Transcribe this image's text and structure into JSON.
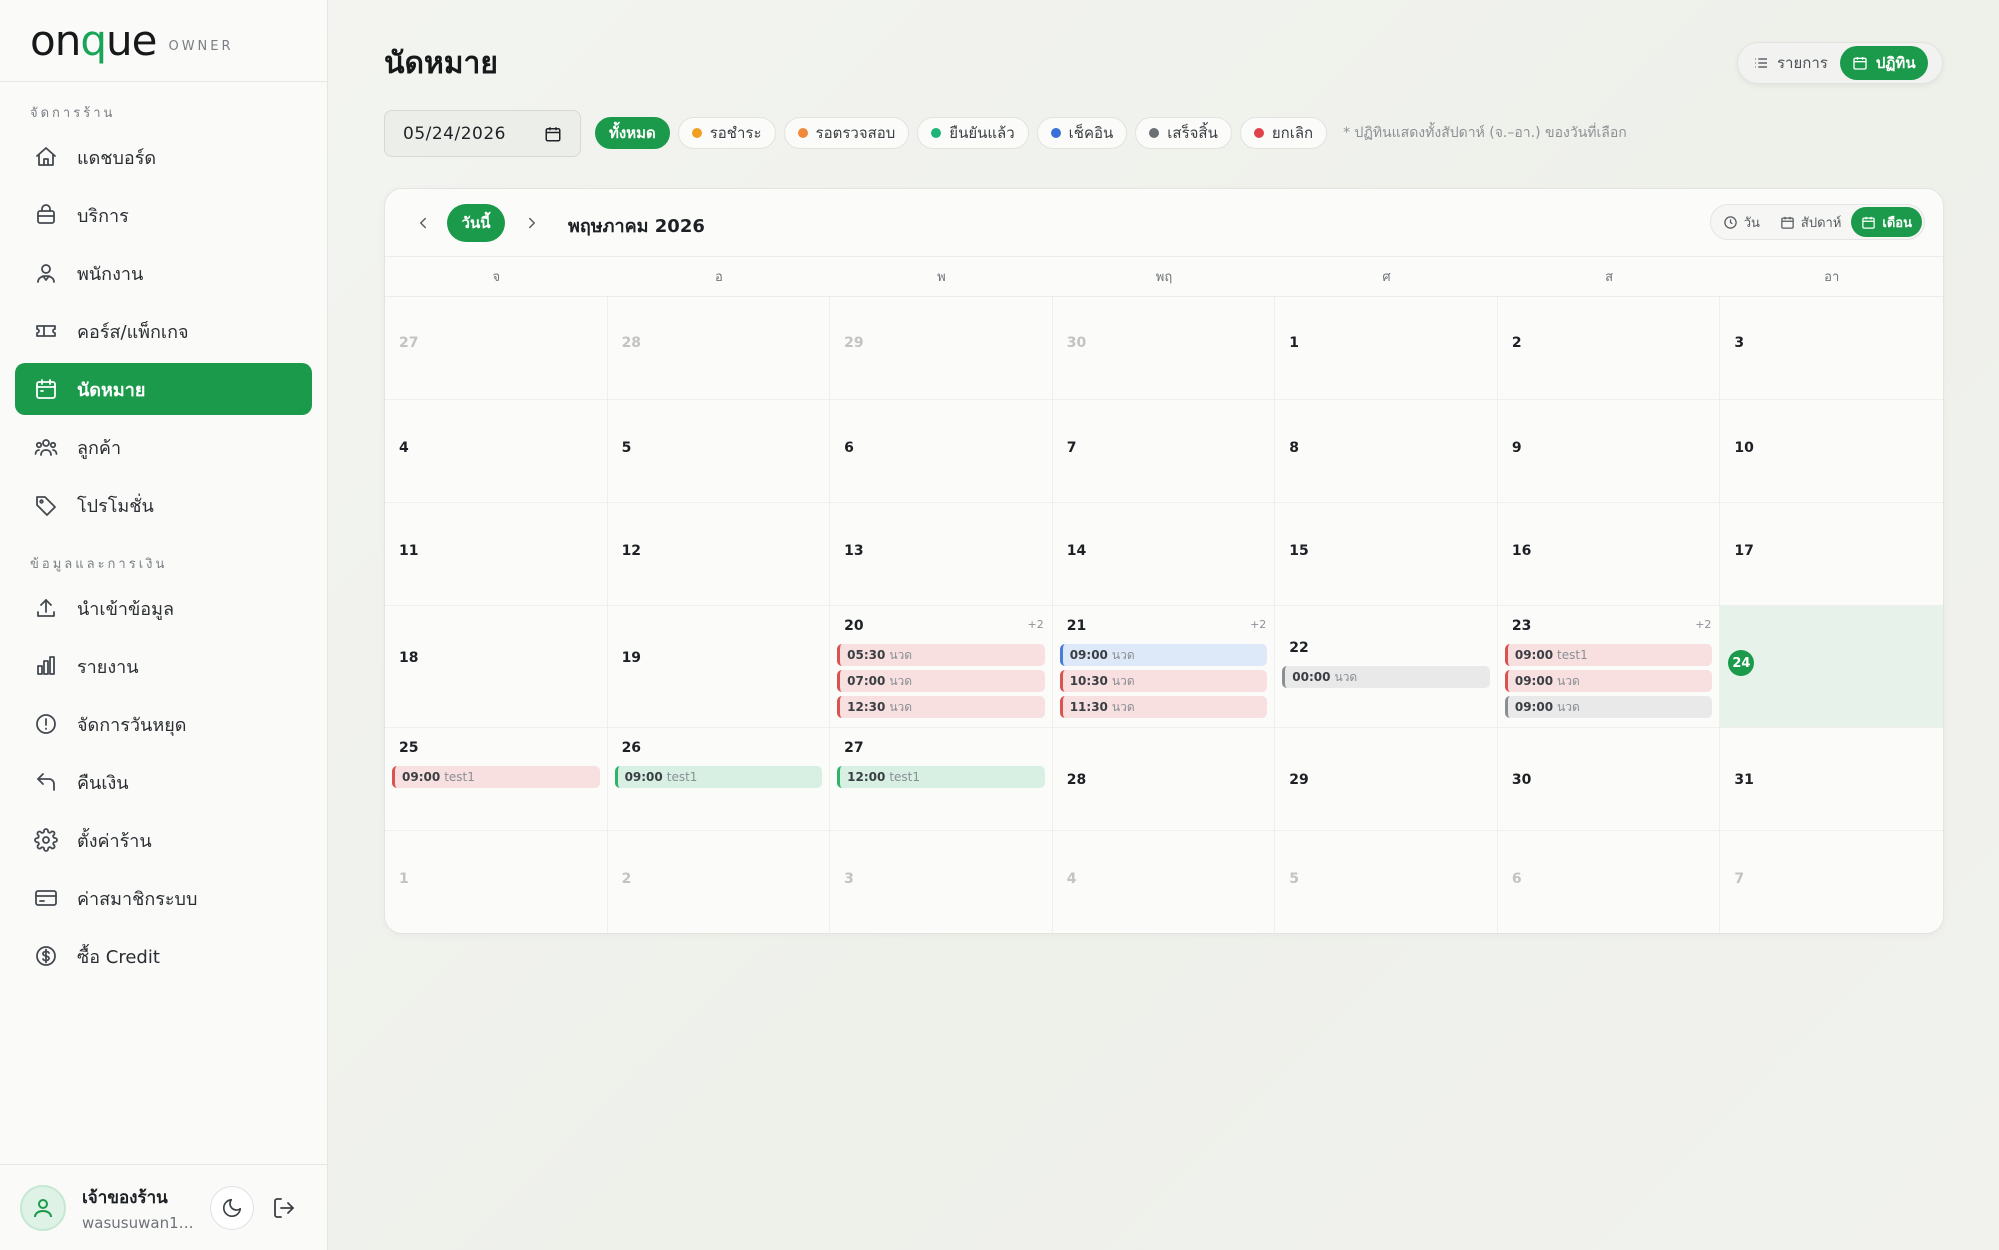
{
  "brand": {
    "logo_pre": "on",
    "logo_q": "q",
    "logo_post": "ue",
    "tag": "OWNER"
  },
  "sidebar": {
    "section1": "จัดการร้าน",
    "items1": [
      {
        "label": "แดชบอร์ด",
        "icon": "home-icon"
      },
      {
        "label": "บริการ",
        "icon": "package-icon"
      },
      {
        "label": "พนักงาน",
        "icon": "staff-icon"
      },
      {
        "label": "คอร์ส/แพ็กเกจ",
        "icon": "ticket-icon"
      },
      {
        "label": "นัดหมาย",
        "icon": "calendar-icon",
        "active": true
      },
      {
        "label": "ลูกค้า",
        "icon": "users-icon"
      },
      {
        "label": "โปรโมชั่น",
        "icon": "tag-icon"
      }
    ],
    "section2": "ข้อมูลและการเงิน",
    "items2": [
      {
        "label": "นำเข้าข้อมูล",
        "icon": "upload-icon"
      },
      {
        "label": "รายงาน",
        "icon": "bar-chart-icon"
      },
      {
        "label": "จัดการวันหยุด",
        "icon": "alert-circle-icon"
      },
      {
        "label": "คืนเงิน",
        "icon": "undo-icon"
      },
      {
        "label": "ตั้งค่าร้าน",
        "icon": "gear-icon"
      },
      {
        "label": "ค่าสมาชิกระบบ",
        "icon": "credit-card-icon"
      },
      {
        "label": "ซื้อ Credit",
        "icon": "dollar-icon"
      }
    ]
  },
  "user": {
    "name": "เจ้าของร้าน",
    "email": "wasusuwan11..."
  },
  "header": {
    "title": "นัดหมาย"
  },
  "view_toggle": {
    "list": "รายการ",
    "calendar": "ปฏิทิน"
  },
  "date_input": {
    "value": "05/24/2026"
  },
  "filters": [
    {
      "label": "ทั้งหมด",
      "active": true
    },
    {
      "label": "รอชำระ",
      "color": "#f0a020"
    },
    {
      "label": "รอตรวจสอบ",
      "color": "#f08a3a"
    },
    {
      "label": "ยืนยันแล้ว",
      "color": "#1fb57a"
    },
    {
      "label": "เช็คอิน",
      "color": "#3b6fd8"
    },
    {
      "label": "เสร็จสิ้น",
      "color": "#6b7075"
    },
    {
      "label": "ยกเลิก",
      "color": "#e0424a"
    }
  ],
  "filter_note": "* ปฏิทินแสดงทั้งสัปดาห์ (จ.–อา.) ของวันที่เลือก",
  "calendar": {
    "today_label": "วันนี้",
    "month_label": "พฤษภาคม 2026",
    "range": {
      "day": "วัน",
      "week": "สัปดาห์",
      "month": "เดือน"
    },
    "dow": [
      "จ",
      "อ",
      "พ",
      "พฤ",
      "ศ",
      "ส",
      "อา"
    ],
    "weeks": [
      [
        {
          "d": "27",
          "muted": true
        },
        {
          "d": "28",
          "muted": true
        },
        {
          "d": "29",
          "muted": true
        },
        {
          "d": "30",
          "muted": true
        },
        {
          "d": "1"
        },
        {
          "d": "2"
        },
        {
          "d": "3"
        }
      ],
      [
        {
          "d": "4"
        },
        {
          "d": "5"
        },
        {
          "d": "6"
        },
        {
          "d": "7"
        },
        {
          "d": "8"
        },
        {
          "d": "9"
        },
        {
          "d": "10"
        }
      ],
      [
        {
          "d": "11"
        },
        {
          "d": "12"
        },
        {
          "d": "13"
        },
        {
          "d": "14"
        },
        {
          "d": "15"
        },
        {
          "d": "16"
        },
        {
          "d": "17"
        }
      ],
      [
        {
          "d": "18"
        },
        {
          "d": "19"
        },
        {
          "d": "20",
          "more": "+2",
          "events": [
            {
              "t": "05:30",
              "n": "นวด",
              "c": "red"
            },
            {
              "t": "07:00",
              "n": "นวด",
              "c": "red"
            },
            {
              "t": "12:30",
              "n": "นวด",
              "c": "red"
            }
          ]
        },
        {
          "d": "21",
          "more": "+2",
          "events": [
            {
              "t": "09:00",
              "n": "นวด",
              "c": "blue"
            },
            {
              "t": "10:30",
              "n": "นวด",
              "c": "red"
            },
            {
              "t": "11:30",
              "n": "นวด",
              "c": "red"
            }
          ]
        },
        {
          "d": "22",
          "events": [
            {
              "t": "00:00",
              "n": "นวด",
              "c": "gray"
            }
          ]
        },
        {
          "d": "23",
          "more": "+2",
          "events": [
            {
              "t": "09:00",
              "n": "test1",
              "c": "red"
            },
            {
              "t": "09:00",
              "n": "นวด",
              "c": "red"
            },
            {
              "t": "09:00",
              "n": "นวด",
              "c": "gray"
            }
          ]
        },
        {
          "d": "24",
          "today": true
        }
      ],
      [
        {
          "d": "25",
          "events": [
            {
              "t": "09:00",
              "n": "test1",
              "c": "red"
            }
          ]
        },
        {
          "d": "26",
          "events": [
            {
              "t": "09:00",
              "n": "test1",
              "c": "green"
            }
          ]
        },
        {
          "d": "27",
          "events": [
            {
              "t": "12:00",
              "n": "test1",
              "c": "green"
            }
          ]
        },
        {
          "d": "28"
        },
        {
          "d": "29"
        },
        {
          "d": "30"
        },
        {
          "d": "31"
        }
      ],
      [
        {
          "d": "1",
          "muted": true
        },
        {
          "d": "2",
          "muted": true
        },
        {
          "d": "3",
          "muted": true
        },
        {
          "d": "4",
          "muted": true
        },
        {
          "d": "5",
          "muted": true
        },
        {
          "d": "6",
          "muted": true
        },
        {
          "d": "7",
          "muted": true
        }
      ]
    ]
  }
}
